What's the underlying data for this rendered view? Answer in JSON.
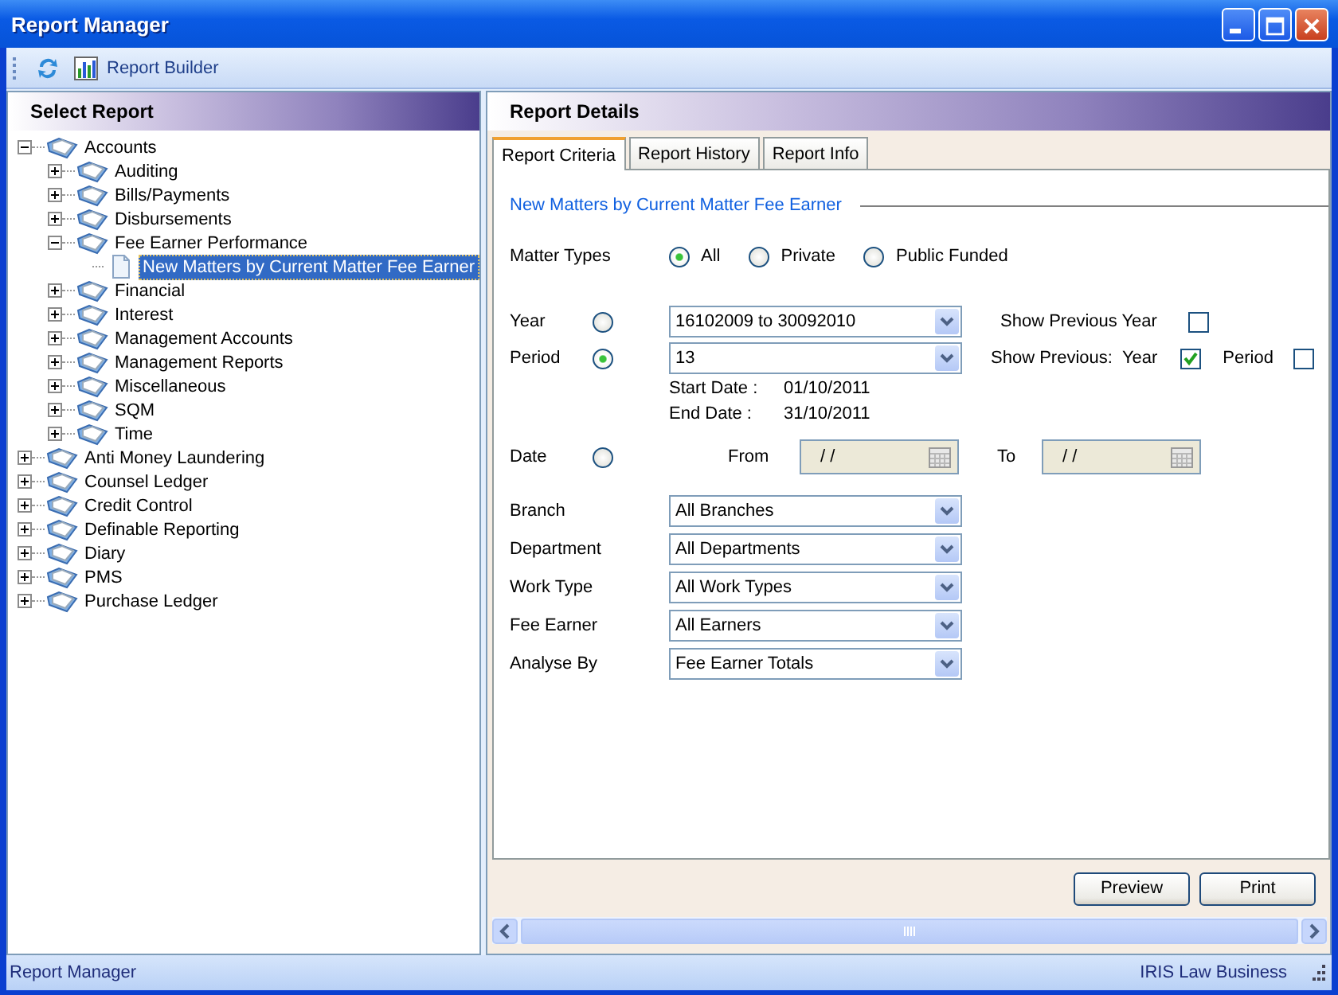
{
  "window": {
    "title": "Report Manager"
  },
  "toolbar": {
    "items": [
      {
        "kind": "refresh"
      },
      {
        "kind": "chart",
        "label": "Report Builder"
      }
    ]
  },
  "left_panel": {
    "title": "Select Report",
    "tree": [
      {
        "label": "Accounts",
        "kind": "folder",
        "expanded": true,
        "selected": false,
        "children": [
          {
            "label": "Auditing",
            "kind": "folder",
            "expanded": false,
            "selected": false
          },
          {
            "label": "Bills/Payments",
            "kind": "folder",
            "expanded": false,
            "selected": false
          },
          {
            "label": "Disbursements",
            "kind": "folder",
            "expanded": false,
            "selected": false
          },
          {
            "label": "Fee Earner Performance",
            "kind": "folder",
            "expanded": true,
            "selected": false,
            "children": [
              {
                "label": "New Matters by Current Matter Fee Earner",
                "kind": "report",
                "selected": true
              }
            ]
          },
          {
            "label": "Financial",
            "kind": "folder",
            "expanded": false,
            "selected": false
          },
          {
            "label": "Interest",
            "kind": "folder",
            "expanded": false,
            "selected": false
          },
          {
            "label": "Management Accounts",
            "kind": "folder",
            "expanded": false,
            "selected": false
          },
          {
            "label": "Management Reports",
            "kind": "folder",
            "expanded": false,
            "selected": false
          },
          {
            "label": "Miscellaneous",
            "kind": "folder",
            "expanded": false,
            "selected": false
          },
          {
            "label": "SQM",
            "kind": "folder",
            "expanded": false,
            "selected": false
          },
          {
            "label": "Time",
            "kind": "folder",
            "expanded": false,
            "selected": false
          }
        ]
      },
      {
        "label": "Anti Money Laundering",
        "kind": "folder",
        "expanded": false,
        "selected": false
      },
      {
        "label": "Counsel Ledger",
        "kind": "folder",
        "expanded": false,
        "selected": false
      },
      {
        "label": "Credit Control",
        "kind": "folder",
        "expanded": false,
        "selected": false
      },
      {
        "label": "Definable Reporting",
        "kind": "folder",
        "expanded": false,
        "selected": false
      },
      {
        "label": "Diary",
        "kind": "folder",
        "expanded": false,
        "selected": false
      },
      {
        "label": "PMS",
        "kind": "folder",
        "expanded": false,
        "selected": false
      },
      {
        "label": "Purchase Ledger",
        "kind": "folder",
        "expanded": false,
        "selected": false
      }
    ]
  },
  "right_panel": {
    "title": "Report Details",
    "tabs": [
      {
        "label": "Report Criteria",
        "selected": true
      },
      {
        "label": "Report History",
        "selected": false
      },
      {
        "label": "Report Info",
        "selected": false
      }
    ],
    "section_title": "New Matters by Current Matter Fee Earner",
    "matter_types": {
      "label": "Matter Types",
      "options": [
        {
          "label": "All",
          "selected": true
        },
        {
          "label": "Private",
          "selected": false
        },
        {
          "label": "Public Funded",
          "selected": false
        }
      ]
    },
    "year": {
      "label": "Year",
      "selected": false,
      "value": "16102009 to 30092010"
    },
    "show_previous_year": {
      "label": "Show Previous Year",
      "checked": false
    },
    "period": {
      "label": "Period",
      "selected": true,
      "value": "13"
    },
    "show_previous": {
      "label": "Show Previous:",
      "year": {
        "label": "Year",
        "checked": true
      },
      "period": {
        "label": "Period",
        "checked": false
      }
    },
    "start_date": {
      "label": "Start Date :",
      "value": "01/10/2011"
    },
    "end_date": {
      "label": "End Date :",
      "value": "31/10/2011"
    },
    "date": {
      "label": "Date",
      "selected": false,
      "from_label": "From",
      "from_value": "/ /",
      "to_label": "To",
      "to_value": "/ /"
    },
    "filters": [
      {
        "label": "Branch",
        "value": "All Branches"
      },
      {
        "label": "Department",
        "value": "All Departments"
      },
      {
        "label": "Work Type",
        "value": "All Work Types"
      },
      {
        "label": "Fee Earner",
        "value": "All Earners"
      },
      {
        "label": "Analyse By",
        "value": "Fee Earner Totals"
      }
    ],
    "buttons": [
      "Preview",
      "Print"
    ]
  },
  "status_bar": {
    "left": "Report Manager",
    "right": "IRIS Law Business"
  }
}
